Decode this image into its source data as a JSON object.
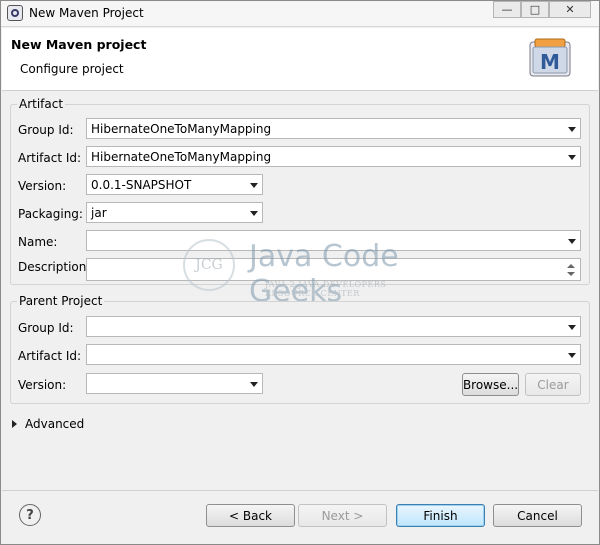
{
  "window": {
    "title": "New Maven Project"
  },
  "banner": {
    "title": "New Maven project",
    "subtitle": "Configure project",
    "icon_letter": "M"
  },
  "artifact": {
    "legend": "Artifact",
    "group_id_label": "Group Id:",
    "group_id_value": "HibernateOneToManyMapping",
    "artifact_id_label": "Artifact Id:",
    "artifact_id_value": "HibernateOneToManyMapping",
    "version_label": "Version:",
    "version_value": "0.0.1-SNAPSHOT",
    "packaging_label": "Packaging:",
    "packaging_value": "jar",
    "name_label": "Name:",
    "name_value": "",
    "description_label": "Description:",
    "description_value": ""
  },
  "parent": {
    "legend": "Parent Project",
    "group_id_label": "Group Id:",
    "group_id_value": "",
    "artifact_id_label": "Artifact Id:",
    "artifact_id_value": "",
    "version_label": "Version:",
    "version_value": "",
    "browse_label": "Browse...",
    "clear_label": "Clear"
  },
  "advanced": {
    "label": "Advanced"
  },
  "footer": {
    "help_symbol": "?",
    "back_label": "< Back",
    "next_label": "Next >",
    "finish_label": "Finish",
    "cancel_label": "Cancel"
  },
  "watermark": {
    "logo_text": "JCG",
    "title": "Java Code Geeks",
    "subtitle": "JAVA 2 JAVA DEVELOPERS RESOURCE CENTER"
  },
  "icons": {
    "app": "eclipse-icon",
    "maven": "maven-icon",
    "help": "help-icon"
  }
}
